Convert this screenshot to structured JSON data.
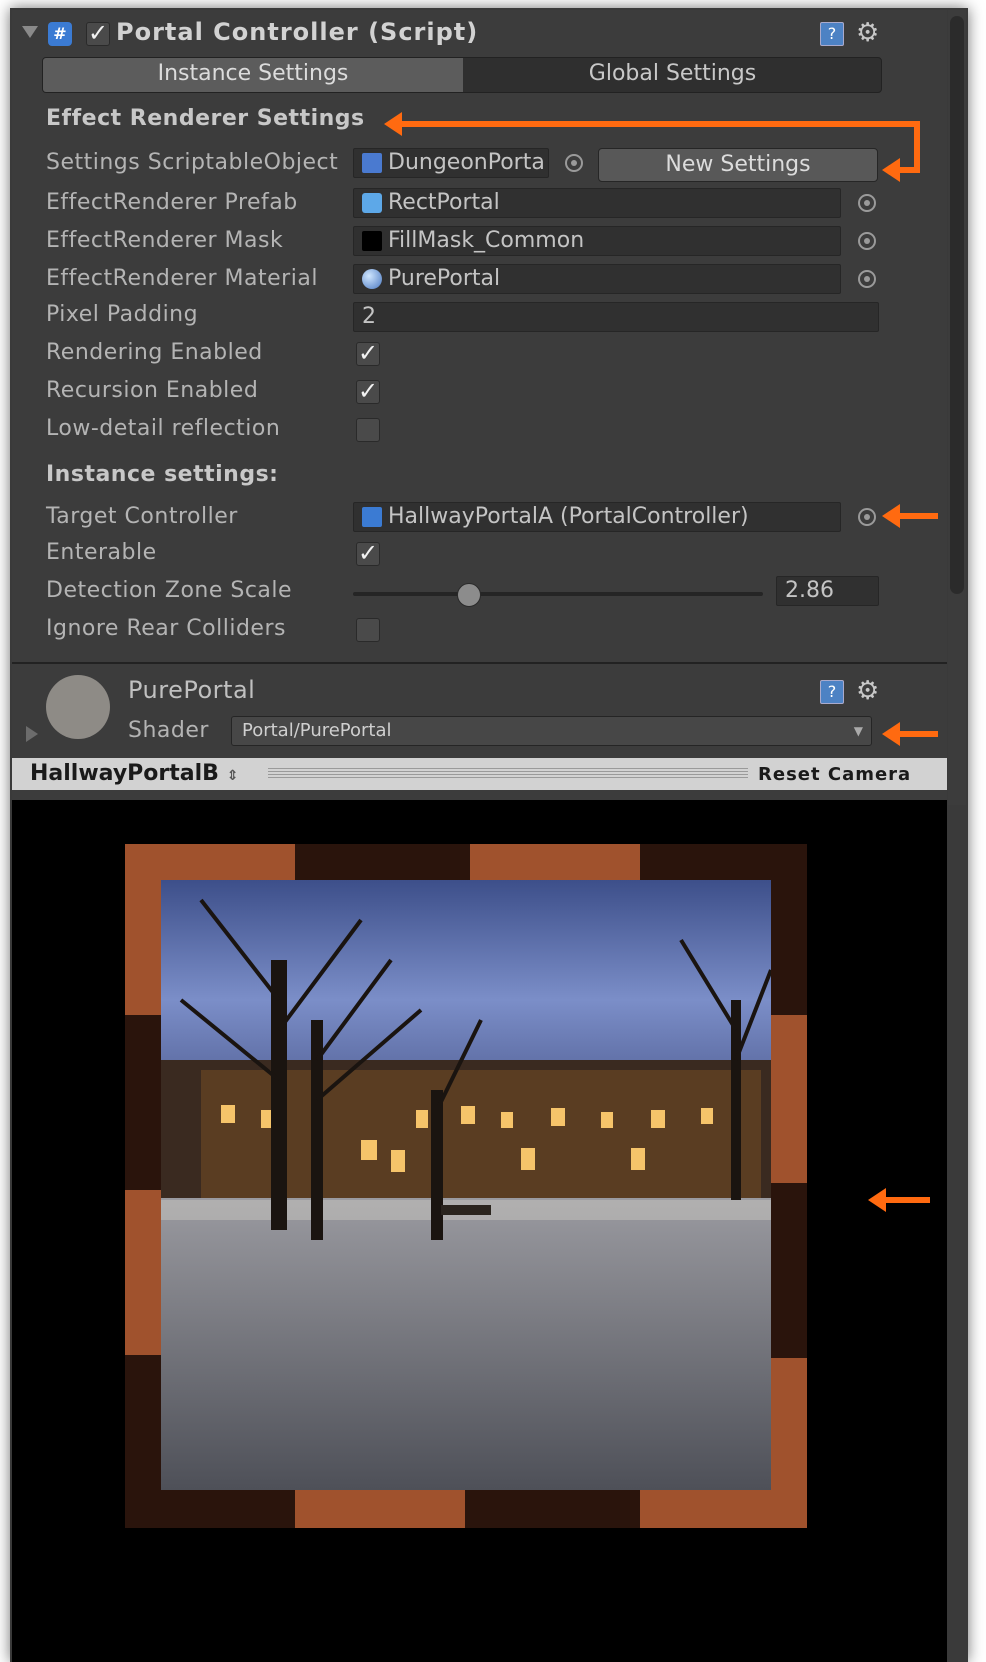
{
  "component": {
    "title": "Portal Controller (Script)",
    "tabs": [
      "Instance Settings",
      "Global Settings"
    ],
    "section_effect": "Effect Renderer Settings",
    "rows": {
      "settings_so": {
        "label": "Settings ScriptableObject",
        "value": "DungeonPorta",
        "button": "New Settings"
      },
      "prefab": {
        "label": "EffectRenderer Prefab",
        "value": "RectPortal"
      },
      "mask": {
        "label": "EffectRenderer Mask",
        "value": "FillMask_Common"
      },
      "material": {
        "label": "EffectRenderer Material",
        "value": "PurePortal"
      },
      "padding": {
        "label": "Pixel Padding",
        "value": "2"
      },
      "rendering": {
        "label": "Rendering Enabled",
        "checked": true
      },
      "recursion": {
        "label": "Recursion Enabled",
        "checked": true
      },
      "lowdetail": {
        "label": "Low-detail reflection",
        "checked": false
      }
    },
    "section_instance": "Instance settings:",
    "instance_rows": {
      "target": {
        "label": "Target Controller",
        "value": "HallwayPortalA (PortalController)"
      },
      "enterable": {
        "label": "Enterable",
        "checked": true
      },
      "zone": {
        "label": "Detection Zone Scale",
        "value": "2.86",
        "slider_fraction": 0.28
      },
      "ignore": {
        "label": "Ignore Rear Colliders",
        "checked": false
      }
    }
  },
  "material": {
    "name": "PurePortal",
    "shader_label": "Shader",
    "shader_value": "Portal/PurePortal"
  },
  "camera_bar": {
    "object": "HallwayPortalB",
    "reset": "Reset Camera"
  },
  "colors": {
    "accent_arrow": "#ff6a10",
    "frame_orange": "#a0522d",
    "frame_dark": "#2a140c"
  },
  "icons": [
    "script-icon",
    "help-icon",
    "gear-icon",
    "foldout-arrow-icon",
    "scriptable-object-icon",
    "prefab-cube-icon",
    "material-sphere-icon",
    "object-picker-icon",
    "dropdown-arrow-icon"
  ]
}
